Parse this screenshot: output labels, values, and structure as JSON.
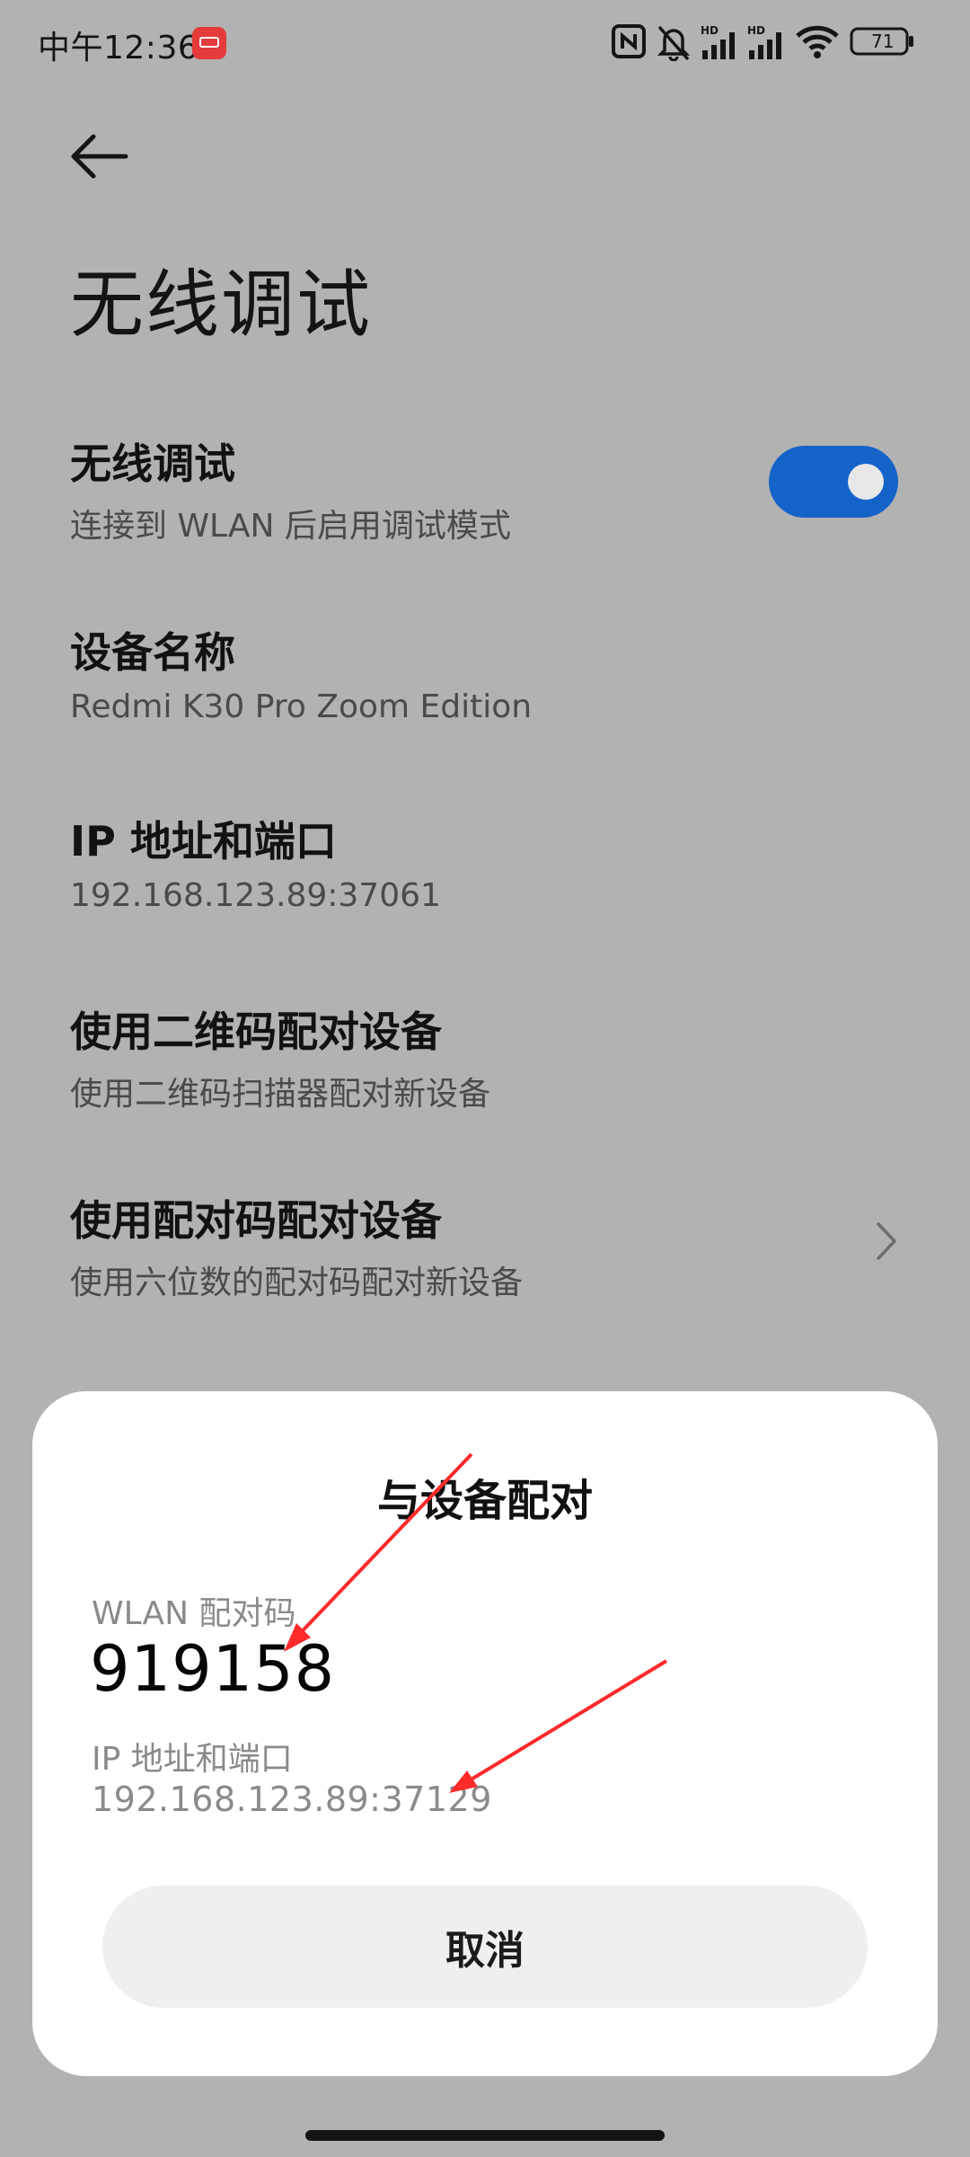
{
  "status_bar": {
    "time": "中午12:36",
    "battery": "71",
    "icons": [
      "app-notification-icon",
      "nfc-icon",
      "mute-icon",
      "hd-signal-icon",
      "hd-signal-icon",
      "wifi-icon",
      "battery-icon"
    ]
  },
  "header": {
    "title": "无线调试"
  },
  "settings": [
    {
      "title": "无线调试",
      "subtitle": "连接到 WLAN 后启用调试模式",
      "toggle_on": true
    },
    {
      "title": "设备名称",
      "subtitle": "Redmi K30 Pro Zoom Edition"
    },
    {
      "title": "IP 地址和端口",
      "subtitle": "192.168.123.89:37061"
    },
    {
      "title": "使用二维码配对设备",
      "subtitle": "使用二维码扫描器配对新设备"
    },
    {
      "title": "使用配对码配对设备",
      "subtitle": "使用六位数的配对码配对新设备"
    }
  ],
  "dialog": {
    "title": "与设备配对",
    "code_label": "WLAN 配对码",
    "code": "919158",
    "ip_label": "IP 地址和端口",
    "ip": "192.168.123.89:37129",
    "cancel_label": "取消"
  },
  "colors": {
    "accent": "#1463c8",
    "annotation": "#ff2a2a",
    "dim_background": "#b2b2b2"
  }
}
